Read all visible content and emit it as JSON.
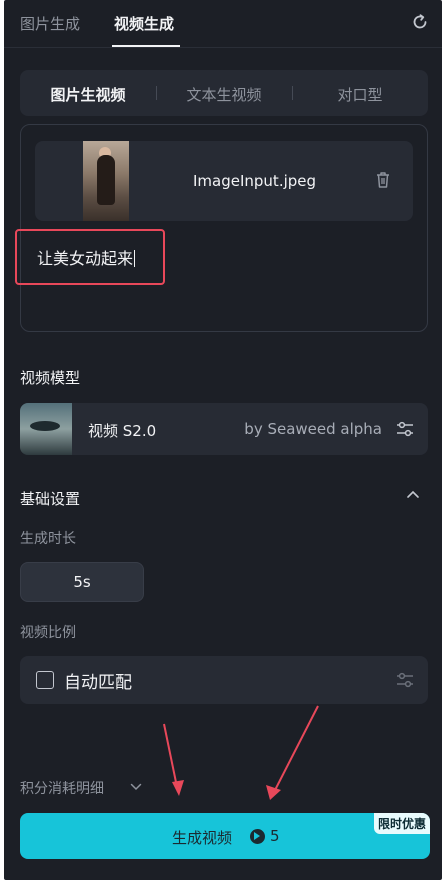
{
  "top_tabs": {
    "image_gen": "图片生成",
    "video_gen": "视频生成"
  },
  "mode_tabs": {
    "image_to_video": "图片生视频",
    "text_to_video": "文本生视频",
    "lip_sync": "对口型"
  },
  "upload": {
    "file_name": "ImageInput.jpeg",
    "prompt": "让美女动起来"
  },
  "model": {
    "section_title": "视频模型",
    "name": "视频 S2.0",
    "provider": "by Seaweed alpha"
  },
  "basic": {
    "section_title": "基础设置",
    "duration_label": "生成时长",
    "duration_value": "5s",
    "ratio_label": "视频比例",
    "ratio_value": "自动匹配"
  },
  "footer": {
    "points_detail": "积分消耗明细",
    "generate_label": "生成视频",
    "generate_cost": "5",
    "promo_badge": "限时优惠"
  },
  "colors": {
    "accent": "#17c4d9",
    "panel_bg": "#1c1f26",
    "highlight": "#e8485a"
  }
}
